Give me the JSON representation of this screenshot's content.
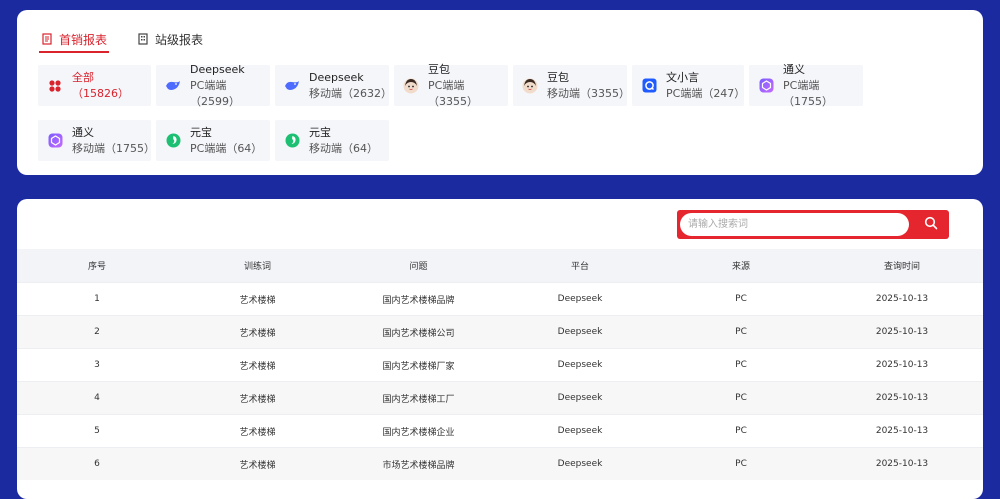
{
  "tabs": [
    {
      "label": "首销报表",
      "active": true,
      "icon": "document-icon"
    },
    {
      "label": "站级报表",
      "active": false,
      "icon": "building-icon"
    }
  ],
  "chips": [
    {
      "name": "全部",
      "sub": "（15826）",
      "icon": "all-icon",
      "active": true
    },
    {
      "name": "Deepseek",
      "sub": "PC端端（2599）",
      "icon": "deepseek-icon"
    },
    {
      "name": "Deepseek",
      "sub": "移动端（2632）",
      "icon": "deepseek-icon"
    },
    {
      "name": "豆包",
      "sub": "PC端端（3355）",
      "icon": "doubao-icon"
    },
    {
      "name": "豆包",
      "sub": "移动端（3355）",
      "icon": "doubao-icon"
    },
    {
      "name": "文小言",
      "sub": "PC端端（247）",
      "icon": "wenxiaoyan-icon"
    },
    {
      "name": "通义",
      "sub": "PC端端（1755）",
      "icon": "tongyi-icon"
    },
    {
      "name": "通义",
      "sub": "移动端（1755）",
      "icon": "tongyi-icon"
    },
    {
      "name": "元宝",
      "sub": "PC端端（64）",
      "icon": "yuanbao-icon"
    },
    {
      "name": "元宝",
      "sub": "移动端（64）",
      "icon": "yuanbao-icon"
    }
  ],
  "search": {
    "placeholder": "请输入搜索词"
  },
  "table": {
    "headers": [
      "序号",
      "训练词",
      "问题",
      "平台",
      "来源",
      "查询时间"
    ],
    "rows": [
      [
        "1",
        "艺术楼梯",
        "国内艺术楼梯品牌",
        "Deepseek",
        "PC",
        "2025-10-13"
      ],
      [
        "2",
        "艺术楼梯",
        "国内艺术楼梯公司",
        "Deepseek",
        "PC",
        "2025-10-13"
      ],
      [
        "3",
        "艺术楼梯",
        "国内艺术楼梯厂家",
        "Deepseek",
        "PC",
        "2025-10-13"
      ],
      [
        "4",
        "艺术楼梯",
        "国内艺术楼梯工厂",
        "Deepseek",
        "PC",
        "2025-10-13"
      ],
      [
        "5",
        "艺术楼梯",
        "国内艺术楼梯企业",
        "Deepseek",
        "PC",
        "2025-10-13"
      ],
      [
        "6",
        "艺术楼梯",
        "市场艺术楼梯品牌",
        "Deepseek",
        "PC",
        "2025-10-13"
      ]
    ]
  },
  "colors": {
    "accent": "#d9232d",
    "background": "#1b2a9e"
  }
}
